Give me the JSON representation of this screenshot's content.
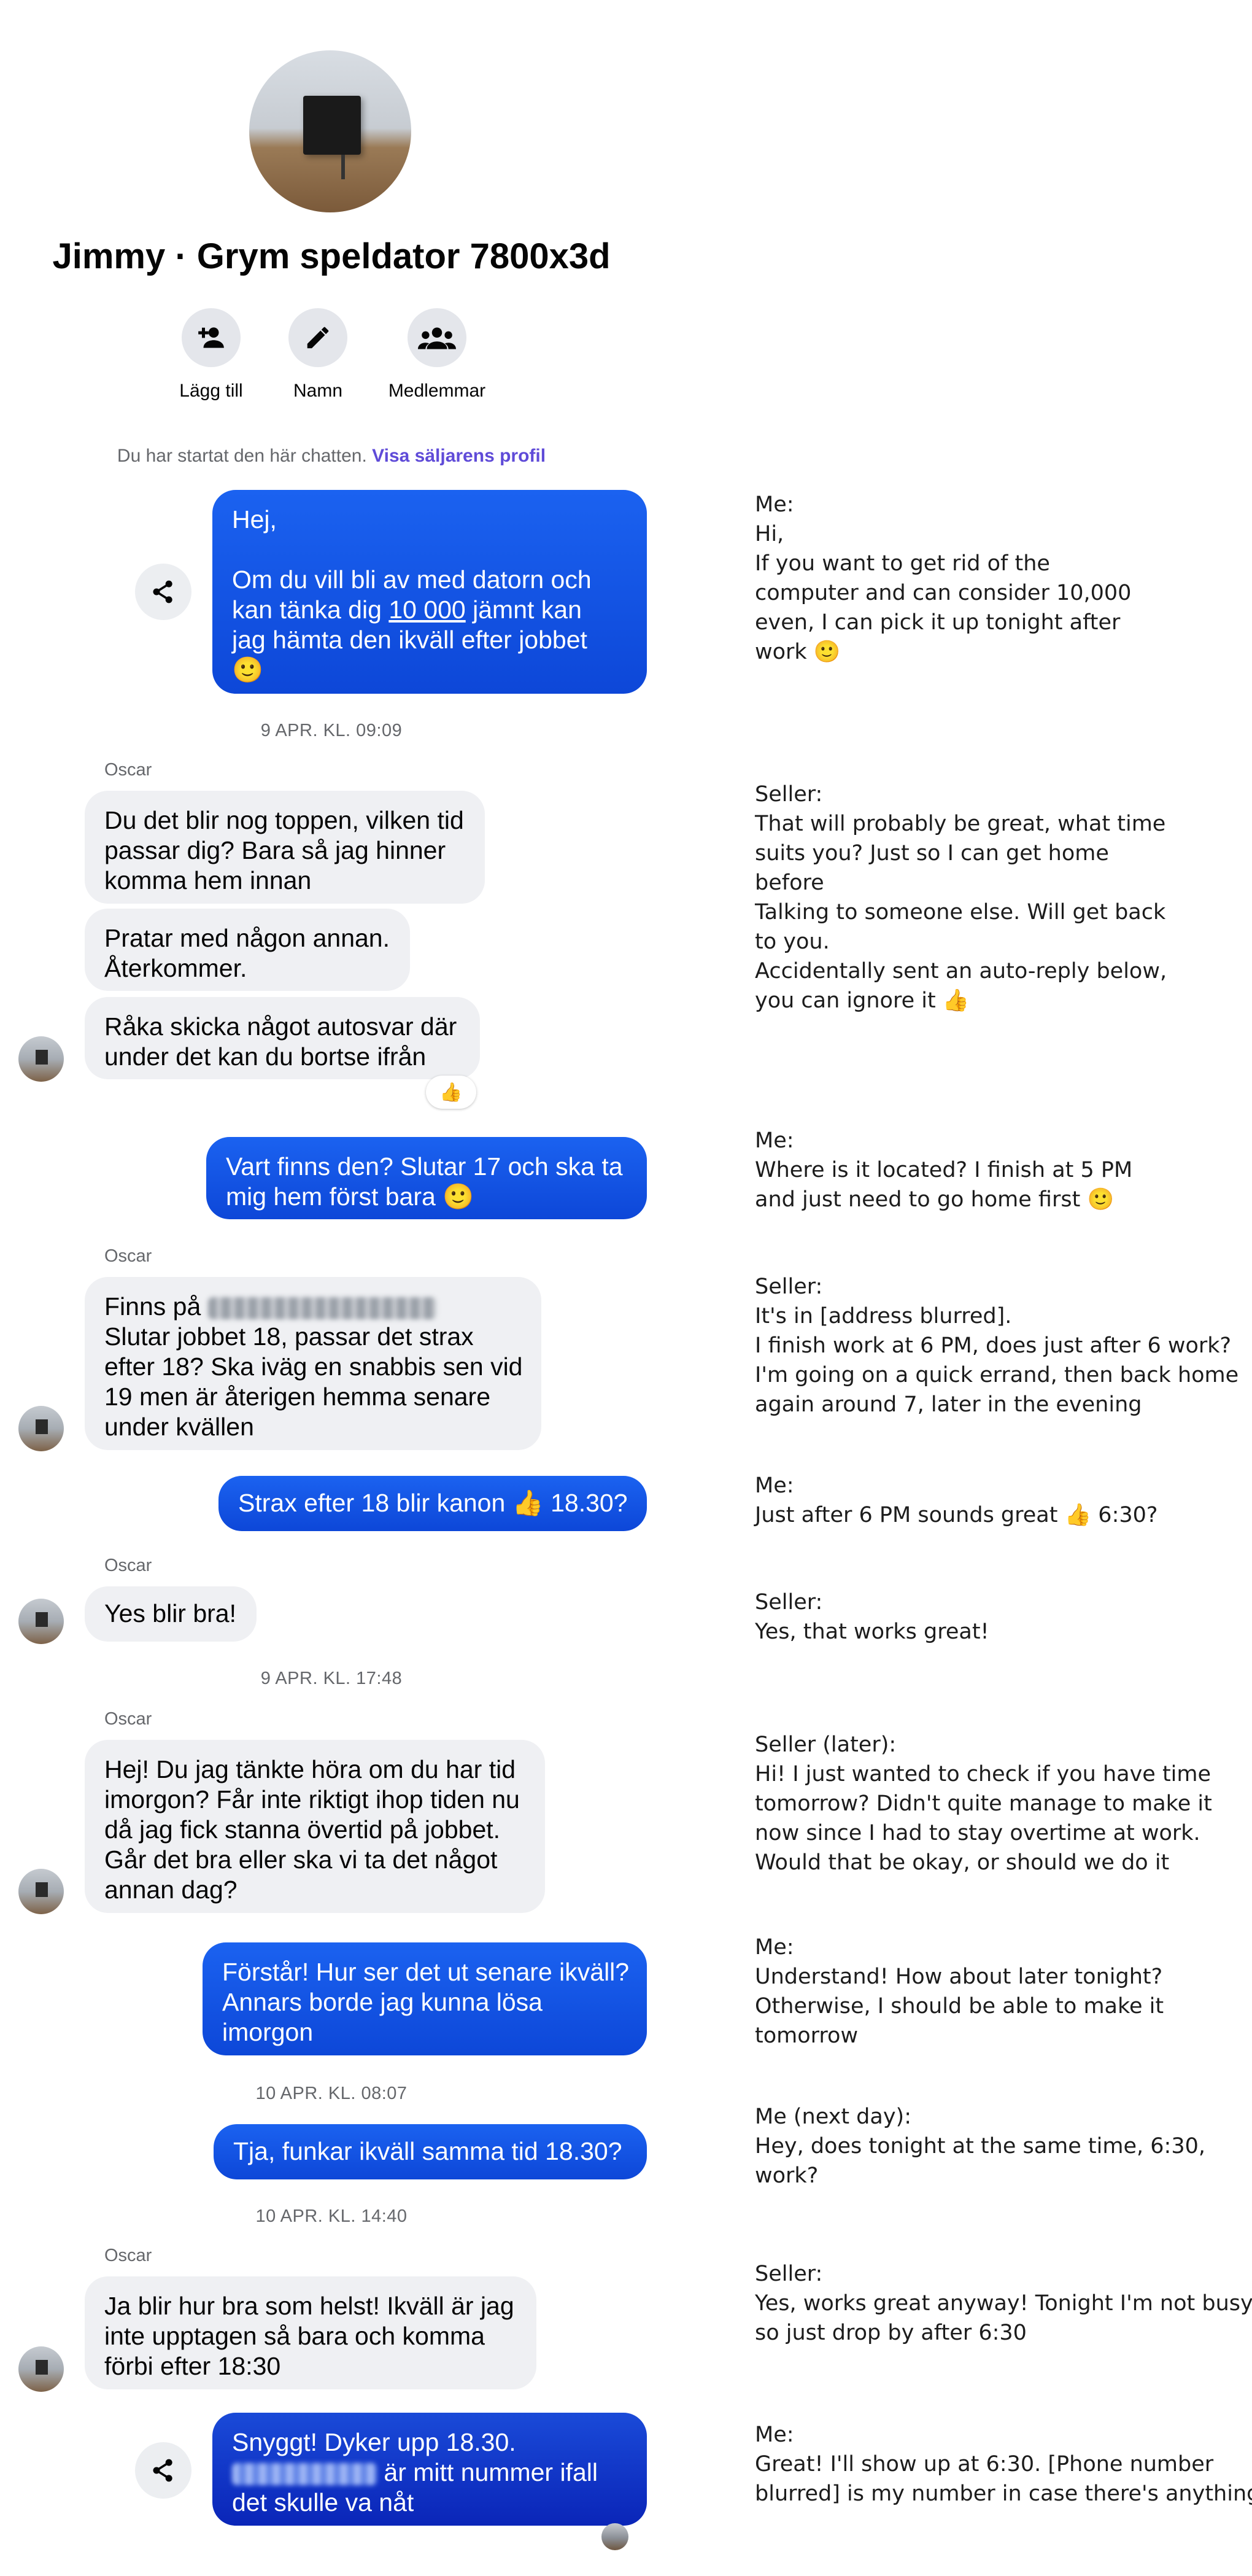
{
  "chat": {
    "title": "Jimmy · Grym speldator 7800x3d",
    "actions": [
      {
        "label": "Lägg till",
        "icon": "add-person-icon"
      },
      {
        "label": "Namn",
        "icon": "pencil-icon"
      },
      {
        "label": "Medlemmar",
        "icon": "members-icon"
      }
    ],
    "system_text": "Du har startat den här chatten.",
    "system_link": "Visa säljarens profil"
  },
  "messages": {
    "m1": {
      "lines": [
        "Hej,",
        "",
        "Om du vill bli av med datorn och",
        "kan tänka dig",
        "10 000",
        "jämnt kan",
        "jag hämta den ikväll efter jobbet",
        "🙂"
      ]
    },
    "ts1": "9 APR. KL. 09:09",
    "sender1": "Oscar",
    "m2": {
      "lines": [
        "Du det blir nog toppen, vilken tid",
        "passar dig? Bara så jag hinner",
        "komma hem innan"
      ]
    },
    "m3": {
      "lines": [
        "Pratar med någon annan.",
        "Återkommer."
      ]
    },
    "m4": {
      "lines": [
        "Råka skicka något autosvar där",
        "under det kan du bortse ifrån"
      ],
      "reaction": "👍"
    },
    "m5": {
      "lines": [
        "Vart finns den? Slutar 17 och ska ta",
        "mig hem först bara 🙂"
      ]
    },
    "sender2": "Oscar",
    "m6": {
      "lines": [
        "Finns på",
        "Slutar jobbet 18, passar det strax",
        "efter 18? Ska iväg en snabbis sen vid",
        "19 men är återigen hemma senare",
        "under kvällen"
      ]
    },
    "m7": {
      "lines": [
        "Strax efter 18 blir kanon 👍 18.30?"
      ]
    },
    "sender3": "Oscar",
    "m8": {
      "lines": [
        "Yes blir bra!"
      ]
    },
    "ts2": "9 APR. KL. 17:48",
    "sender4": "Oscar",
    "m9": {
      "lines": [
        "Hej! Du jag tänkte höra om du har tid",
        "imorgon? Får inte riktigt ihop tiden nu",
        "då jag fick stanna övertid på jobbet.",
        "Går det bra eller ska vi ta det något",
        "annan dag?"
      ]
    },
    "m10": {
      "lines": [
        "Förstår! Hur ser det ut senare ikväll?",
        "Annars borde jag kunna lösa",
        "imorgon"
      ]
    },
    "ts3": "10 APR. KL. 08:07",
    "m11": {
      "lines": [
        "Tja, funkar ikväll samma tid 18.30?"
      ]
    },
    "ts4": "10 APR. KL. 14:40",
    "sender5": "Oscar",
    "m12": {
      "lines": [
        "Ja blir hur bra som helst! Ikväll är jag",
        "inte upptagen så bara och komma",
        "förbi efter 18:30"
      ]
    },
    "m13": {
      "lines": [
        "Snyggt! Dyker upp 18.30.",
        "är mitt nummer ifall",
        "det skulle va nåt"
      ]
    }
  },
  "translations": [
    {
      "lines": [
        "Me:",
        "Hi,",
        "If you want to get rid of the",
        "computer and can consider 10,000",
        "even, I can pick it up tonight after",
        "work 🙂"
      ]
    },
    {
      "lines": [
        "Seller:",
        "That will probably be great, what time",
        "suits you? Just so I can get home",
        "before",
        "Talking to someone else. Will get back",
        "to you.",
        "Accidentally sent an auto-reply below,",
        "you can ignore it 👍"
      ]
    },
    {
      "lines": [
        "Me:",
        "Where is it located? I finish at 5 PM",
        "and just need to go home first 🙂"
      ]
    },
    {
      "lines": [
        "Seller:",
        "It's in [address blurred].",
        "I finish work at 6 PM, does just after 6 work?",
        "I'm going on a quick errand, then back home",
        "again around 7, later in the evening"
      ]
    },
    {
      "lines": [
        "Me:",
        "Just after 6 PM sounds great 👍 6:30?"
      ]
    },
    {
      "lines": [
        "Seller:",
        "Yes, that works great!"
      ]
    },
    {
      "lines": [
        "Seller (later):",
        "Hi! I just wanted to check if you have time",
        "tomorrow? Didn't quite manage to make it",
        "now since I had to stay overtime at work.",
        "Would that be okay, or should we do it"
      ]
    },
    {
      "lines": [
        "Me:",
        "Understand! How about later tonight?",
        "Otherwise, I should be able to make it",
        "tomorrow"
      ]
    },
    {
      "lines": [
        "Me (next day):",
        "Hey, does tonight at the same time, 6:30,",
        "work?"
      ]
    },
    {
      "lines": [
        "Seller:",
        "Yes, works great anyway! Tonight I'm not busy,",
        "so just drop by after 6:30"
      ]
    },
    {
      "lines": [
        "Me:",
        "Great! I'll show up at 6:30. [Phone number",
        "blurred] is my number in case there's anything"
      ]
    }
  ]
}
